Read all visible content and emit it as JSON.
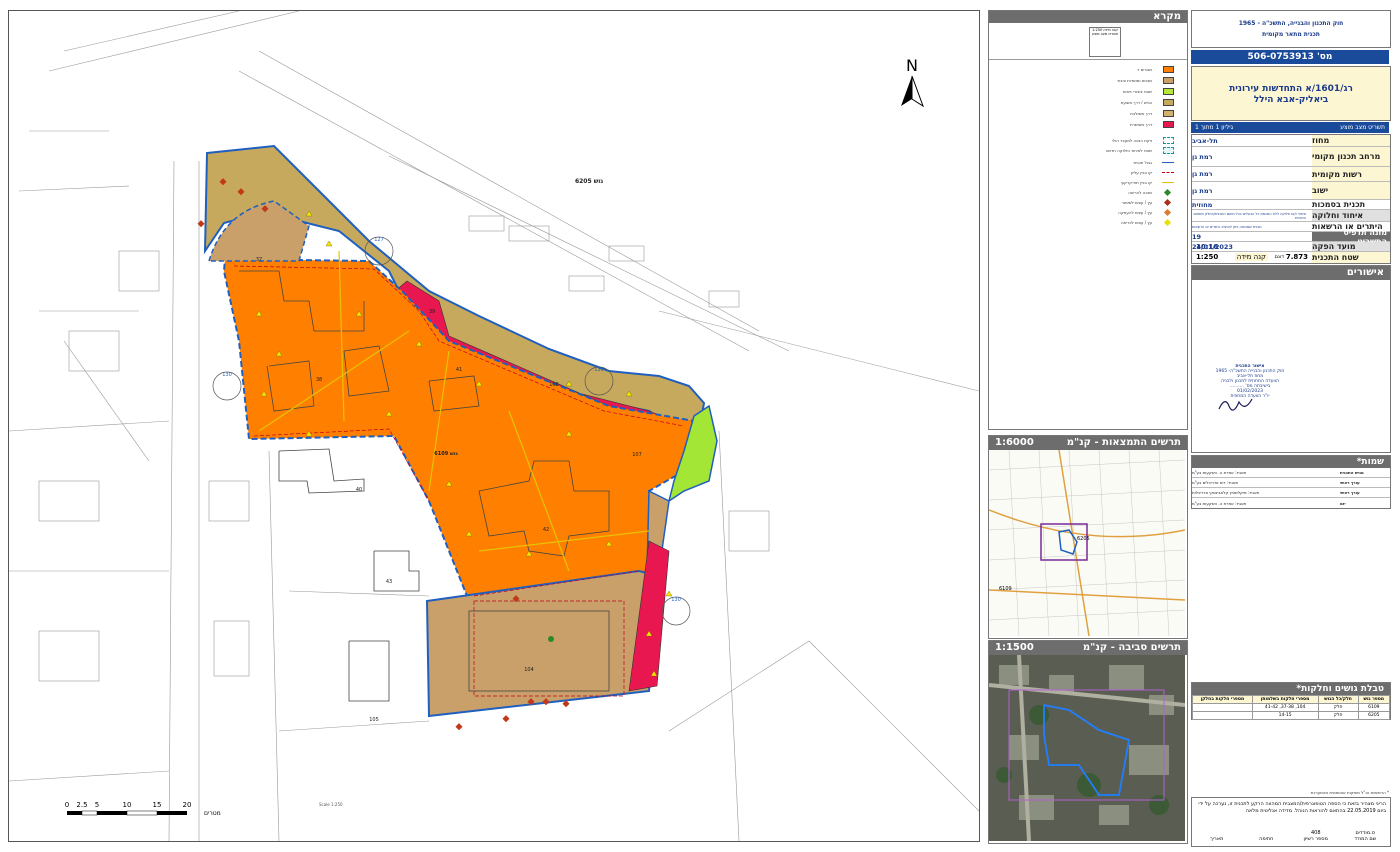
{
  "map": {
    "north_label": "N",
    "block_labels": [
      "גוש 6205",
      "גוש 6109"
    ],
    "parcel_numbers": [
      "37",
      "38",
      "39",
      "40",
      "41",
      "42",
      "43",
      "104",
      "105",
      "106",
      "107"
    ],
    "area_labels": [
      "127",
      "130",
      "130",
      "130"
    ],
    "scale_bar": {
      "ticks": [
        "0",
        "2.5",
        "5",
        "10",
        "15",
        "20"
      ],
      "unit": "מטרים"
    },
    "scale_text": "Scale 1:250",
    "colors": {
      "residential_orange": "#ff8000",
      "commercial_brown": "#c9a06a",
      "open_space_green": "#a3e635",
      "road_red": "#e8174f",
      "path_olive": "#c6a95c",
      "boundary_blue": "#1f5fbf"
    }
  },
  "legend": {
    "title": "מקרא",
    "items": [
      {
        "label": "מגורים ד",
        "color": "#ff8000"
      },
      {
        "label": "מבנים ומוסדות ציבור",
        "color": "#c9a06a"
      },
      {
        "label": "שטח ציבורי פתוח",
        "color": "#b6e63a"
      },
      {
        "label": "כביש / דרך מוצעת",
        "color": "#c6a95c"
      },
      {
        "label": "דרך משולבת",
        "color": "#d2b06d"
      },
      {
        "label": "דרך מאושרת",
        "color": "#e8174f"
      }
    ],
    "symbols": [
      "זיקת הנאה למעבר רגלי",
      "שטח לאיחוד וחלוקה חדשה",
      "גבול תכנית",
      "קו בניין עליון",
      "קו בניין תת-קרקעי",
      "מבנה להריסה",
      "עץ / עצים לשימור",
      "עץ / עצים להעתקה",
      "עץ / עצים לכריתה"
    ],
    "stamp_lines": [
      "קנה מידה 1:250",
      "תשריט מצב מוצע"
    ]
  },
  "location_sketch": {
    "title": "תרשים התמצאות - קנ\"מ",
    "scale": "1:6000",
    "block_labels": [
      "6205",
      "6109"
    ]
  },
  "surroundings_sketch": {
    "title": "תרשים סביבה - קנ\"מ",
    "scale": "1:1500"
  },
  "info": {
    "law_title": "חוק התכנון והבנייה, התשכ\"ה - 1965",
    "plan_type": "תכנית מתאר מקומית",
    "plan_number": "מס' 506-0753913",
    "plan_name_line1": "רג/1601/א התחדשות עירונית",
    "plan_name_line2": "ביאליק-אבא הילל",
    "sheet_label": "תשריט מצב מוצע",
    "sheet_number": "גיליון 1 מתוך 1",
    "rows": [
      {
        "label": "מחוז",
        "value": "תל-אביב"
      },
      {
        "label": "מרחב תכנון מקומי",
        "value": "רמת גן"
      },
      {
        "label": "רשות מקומית",
        "value": "רמת גן"
      },
      {
        "label": "ישוב",
        "value": "רמת גן"
      }
    ],
    "authority_label": "תכנית בסמכות",
    "authority_value": "מחוזית",
    "merge_label": "איחוד וחלוקה",
    "merge_value": "איחוד ו/או חלוקה ללא הסכמת כל הבעלים בכל תחום התכנית/בחלק מתחום התכנית",
    "permits_label": "היתרים או הרשאות",
    "permits_value": "תכנית שמכוחה ניתן להוציא היתרים או הרשאות",
    "version_label": "מונה תדפיס התשריט",
    "version_value": "19",
    "date_label": "מועד הפקה",
    "date_value": "24/01/2023",
    "time_value": "10:16",
    "area_label": "שטח התכנית",
    "area_value": "7.873",
    "area_unit": "דונם",
    "scale_label": "קנה מידה",
    "scale_value": "1:250"
  },
  "approvals": {
    "title": "אישורים",
    "stamp_lines": [
      "אישור התכנית",
      "חוק התכנון והבנייה התשכ\"ה- 1965",
      "מחוז תל-אביב",
      "הוועדה המחוזית לתכנון ולבניה",
      "בישיבתה מס' ..........",
      "01/02/2023",
      "יו\"ר הוועדה המחוזית"
    ]
  },
  "names": {
    "title": "שמות*",
    "rows": [
      {
        "role": "מגיש התכנית",
        "name": "תאגיד: אפרת ה. השקעות בע\"מ"
      },
      {
        "role": "עורך ראשי",
        "name": "תאגיד: דיס אדריכלים בע\"מ"
      },
      {
        "role": "עורך ראשי",
        "name": "תאגיד: מיקלשטיין קלאבינסקי אדריכלות"
      },
      {
        "role": "יזם",
        "name": "תאגיד: אפרת ה. השקעות בע\"מ"
      }
    ]
  },
  "parcels_table": {
    "title": "טבלת גושים וחלקות*",
    "headers": [
      "מספר גוש",
      "חלק/כל הגוש",
      "מספרי חלקות בשלמותן",
      "מספרי חלקות בחלקן"
    ],
    "rows": [
      [
        "6109",
        "חלק",
        "104, 37-38, 41-42",
        ""
      ],
      [
        "6205",
        "חלק",
        "14-15",
        ""
      ]
    ]
  },
  "footer": {
    "note": "* הרשימות הנ\"ל מופקות אוטומטית מהמערכת",
    "declaration": "הריני מצהיר בזאת כי הספה הטופוגרפית/המצבית המהווה הרקע לתכנית זו, נערכה על ידי ביום 22.05.2019 בהתאם להוראות הנוהל. מדידה אנליטית מלאה",
    "surveyor_label": "שם המודד",
    "surveyor_value": "ס.מודדים",
    "license_label": "מספר רשיון",
    "license_value": "408",
    "signature_label": "חתימה",
    "date_label": "תאריך"
  }
}
